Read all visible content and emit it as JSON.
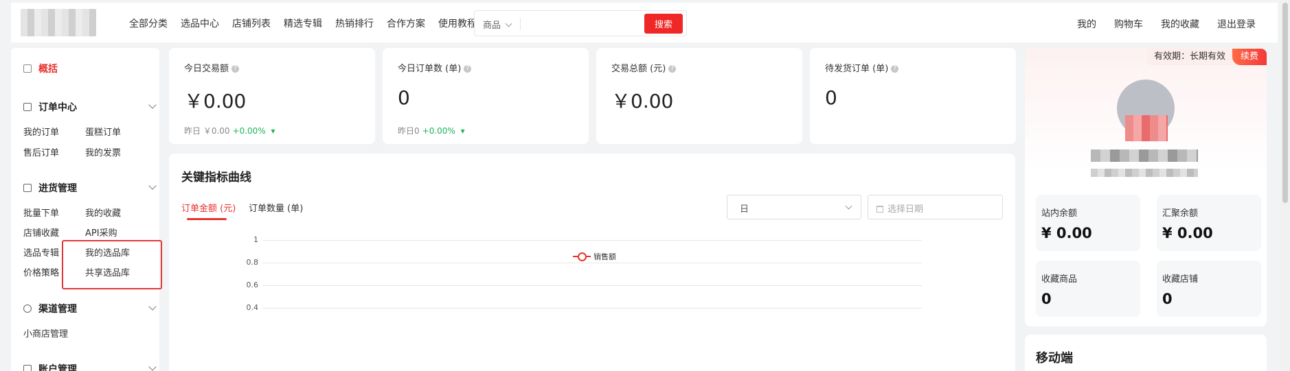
{
  "header": {
    "nav": [
      "全部分类",
      "选品中心",
      "店铺列表",
      "精选专辑",
      "热销排行",
      "合作方案",
      "使用教程"
    ],
    "search": {
      "category": "商品",
      "placeholder": "",
      "button": "搜索"
    },
    "user_links": [
      "我的",
      "购物车",
      "我的收藏",
      "退出登录"
    ]
  },
  "sidebar": {
    "overview": "概括",
    "order_center": {
      "title": "订单中心",
      "links": [
        "我的订单",
        "蛋糕订单",
        "售后订单",
        "我的发票"
      ]
    },
    "purchase": {
      "title": "进货管理",
      "links": [
        "批量下单",
        "我的收藏",
        "店铺收藏",
        "API采购",
        "选品专辑",
        "我的选品库",
        "价格策略",
        "共享选品库"
      ]
    },
    "channel": {
      "title": "渠道管理",
      "links": [
        "小商店管理"
      ]
    },
    "account": {
      "title": "账户管理"
    }
  },
  "stats": [
    {
      "label": "今日交易额",
      "value": "￥0.00",
      "yesterday": "昨日 ￥0.00",
      "change": "+0.00%"
    },
    {
      "label": "今日订单数 (单)",
      "value": "0",
      "yesterday": "昨日0",
      "change": "+0.00%"
    },
    {
      "label": "交易总额 (元)",
      "value": "￥0.00"
    },
    {
      "label": "待发货订单 (单)",
      "value": "0"
    }
  ],
  "chart_panel": {
    "title": "关键指标曲线",
    "tabs": [
      "订单金额 (元)",
      "订单数量 (单)"
    ],
    "period": "日",
    "date_placeholder": "选择日期"
  },
  "chart_data": {
    "type": "line",
    "series": [
      {
        "name": "销售额",
        "values": []
      }
    ],
    "yticks": [
      "1",
      "0.8",
      "0.6",
      "0.4"
    ],
    "ylim": [
      0,
      1
    ],
    "grid": true,
    "legend": "top-center",
    "color": "#e8322e"
  },
  "profile": {
    "validity": "有效期：长期有效",
    "renew": "续费",
    "balances": [
      {
        "label": "站内余额",
        "value": "¥ 0.00"
      },
      {
        "label": "汇聚余额",
        "value": "¥ 0.00"
      },
      {
        "label": "收藏商品",
        "value": "0"
      },
      {
        "label": "收藏店铺",
        "value": "0"
      }
    ]
  },
  "mobile": {
    "title": "移动端"
  },
  "colors": {
    "accent": "#e8322e",
    "up": "#19b558"
  }
}
